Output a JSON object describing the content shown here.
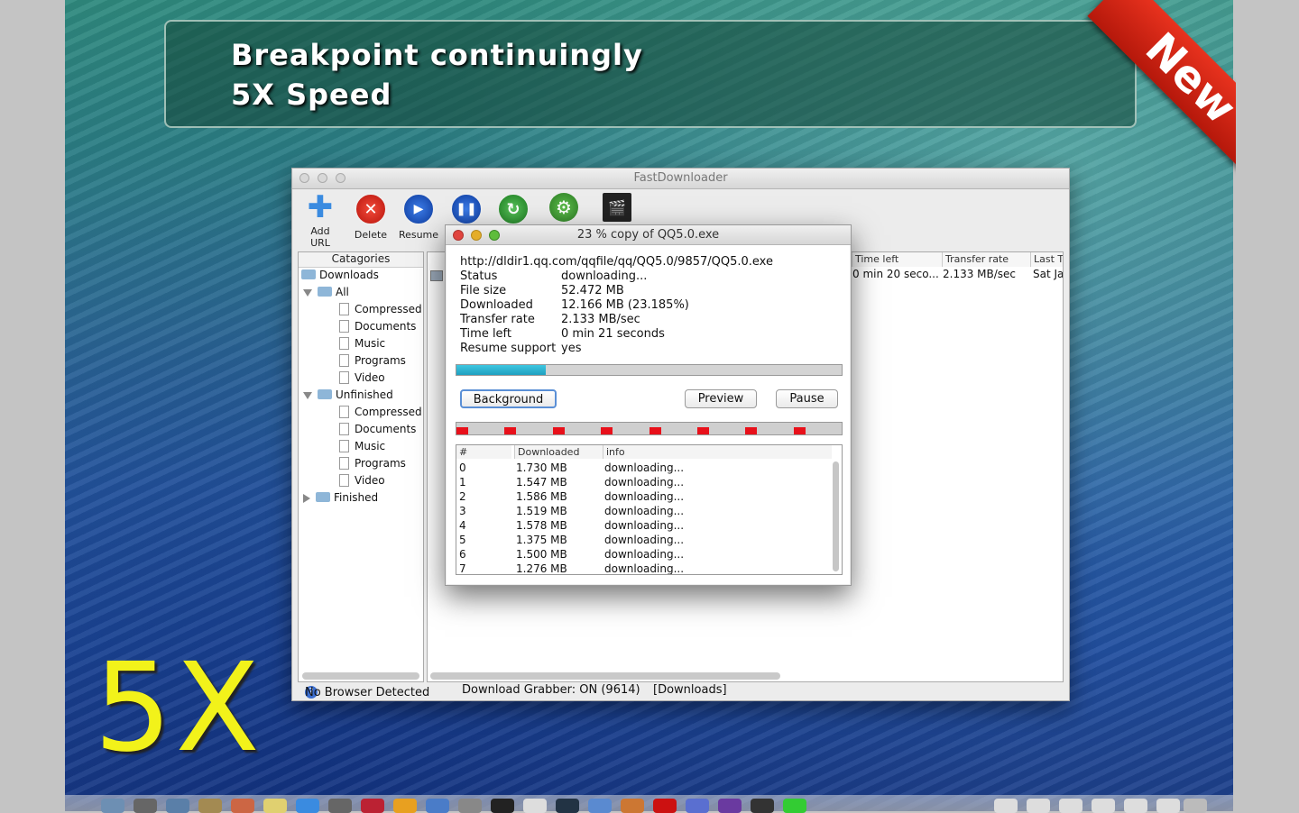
{
  "banner": {
    "line1": "Breakpoint continuingly",
    "line2": "5X Speed",
    "ribbon": "New",
    "big_text": "5X"
  },
  "window": {
    "title": "FastDownloader",
    "toolbar": [
      {
        "label": "Add URL",
        "icon": "add-icon"
      },
      {
        "label": "Delete",
        "icon": "delete-icon"
      },
      {
        "label": "Resume",
        "icon": "play-icon"
      },
      {
        "label": "",
        "icon": "pause-icon"
      },
      {
        "label": "",
        "icon": "refresh-icon"
      },
      {
        "label": "",
        "icon": "gear-icon"
      },
      {
        "label": "",
        "icon": "clapperboard-icon"
      }
    ],
    "categories": {
      "header": "Catagories",
      "root": "Downloads",
      "all": "All",
      "all_children": [
        "Compressed",
        "Documents",
        "Music",
        "Programs",
        "Video"
      ],
      "unfinished": "Unfinished",
      "unfinished_children": [
        "Compressed",
        "Documents",
        "Music",
        "Programs",
        "Video"
      ],
      "finished": "Finished"
    },
    "list": {
      "columns": [
        "Time left",
        "Transfer rate",
        "Last T"
      ],
      "row": [
        "0 min 20 seco...",
        "2.133 MB/sec",
        "Sat Jai"
      ]
    },
    "status": {
      "browser": "No Browser Detected",
      "grabber": "Download Grabber: ON (9614)",
      "folder": "[Downloads]"
    }
  },
  "dialog": {
    "title": "23 % copy of QQ5.0.exe",
    "url": "http://dldir1.qq.com/qqfile/qq/QQ5.0/9857/QQ5.0.exe",
    "fields": [
      {
        "k": "Status",
        "v": "downloading..."
      },
      {
        "k": "File size",
        "v": "52.472 MB"
      },
      {
        "k": "Downloaded",
        "v": "12.166 MB (23.185%)"
      },
      {
        "k": "Transfer rate",
        "v": "2.133 MB/sec"
      },
      {
        "k": "Time left",
        "v": "0 min 21 seconds"
      },
      {
        "k": "Resume support",
        "v": "yes"
      }
    ],
    "progress": 0.23185,
    "buttons": {
      "background": "Background",
      "preview": "Preview",
      "pause": "Pause"
    },
    "segment_count": 8,
    "table": {
      "headers": [
        "#",
        "Downloaded",
        "info"
      ],
      "rows": [
        [
          "0",
          "1.730 MB",
          "downloading..."
        ],
        [
          "1",
          "1.547 MB",
          "downloading..."
        ],
        [
          "2",
          "1.586 MB",
          "downloading..."
        ],
        [
          "3",
          "1.519 MB",
          "downloading..."
        ],
        [
          "4",
          "1.578 MB",
          "downloading..."
        ],
        [
          "5",
          "1.375 MB",
          "downloading..."
        ],
        [
          "6",
          "1.500 MB",
          "downloading..."
        ],
        [
          "7",
          "1.276 MB",
          "downloading..."
        ]
      ]
    }
  },
  "colors": {
    "progress": "#1fa0c0",
    "segment": "#e8101a",
    "ribbon": "#d42514",
    "big_text": "#f2f21a"
  }
}
